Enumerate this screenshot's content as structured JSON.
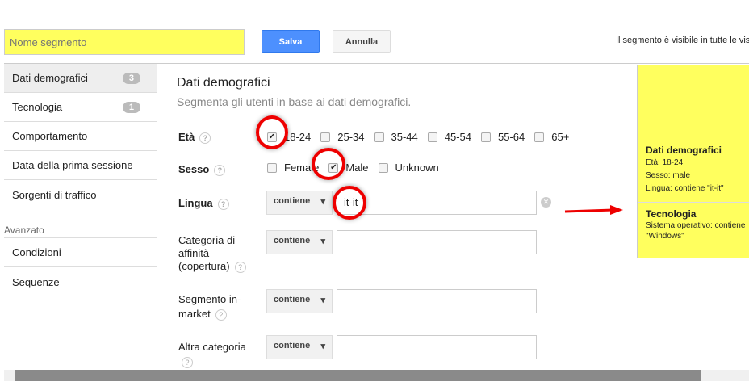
{
  "header": {
    "name_placeholder": "Nome segmento",
    "save": "Salva",
    "cancel": "Annulla",
    "visibility": "Il segmento è visibile in tutte le vis"
  },
  "sidebar": {
    "items": [
      {
        "label": "Dati demografici",
        "badge": "3"
      },
      {
        "label": "Tecnologia",
        "badge": "1"
      },
      {
        "label": "Comportamento"
      },
      {
        "label": "Data della prima sessione"
      },
      {
        "label": "Sorgenti di traffico"
      }
    ],
    "advanced_label": "Avanzato",
    "advanced": [
      {
        "label": "Condizioni"
      },
      {
        "label": "Sequenze"
      }
    ]
  },
  "main": {
    "title": "Dati demografici",
    "subtitle": "Segmenta gli utenti in base ai dati demografici.",
    "age_label": "Età",
    "ages": [
      {
        "label": "18-24",
        "checked": true
      },
      {
        "label": "25-34"
      },
      {
        "label": "35-44"
      },
      {
        "label": "45-54"
      },
      {
        "label": "55-64"
      },
      {
        "label": "65+"
      }
    ],
    "sex_label": "Sesso",
    "sexes": [
      {
        "label": "Female"
      },
      {
        "label": "Male",
        "checked": true
      },
      {
        "label": "Unknown"
      }
    ],
    "language_label": "Lingua",
    "language_op": "contiene",
    "language_value": "it-it",
    "affinity_label": "Categoria di affinità (copertura)",
    "affinity_op": "contiene",
    "inmarket_label": "Segmento in-market",
    "inmarket_op": "contiene",
    "other_label": "Altra categoria",
    "other_op": "contiene",
    "help": "?"
  },
  "summary": {
    "demo_title": "Dati demografici",
    "demo_lines": [
      "Età: 18-24",
      "Sesso: male",
      "Lingua: contiene \"it-it\""
    ],
    "tech_title": "Tecnologia",
    "tech_line": "Sistema operativo: contiene \"Windows\""
  },
  "colors": {
    "highlight": "#ffff5e",
    "primary": "#4d90fe",
    "annotation": "#e00000"
  }
}
